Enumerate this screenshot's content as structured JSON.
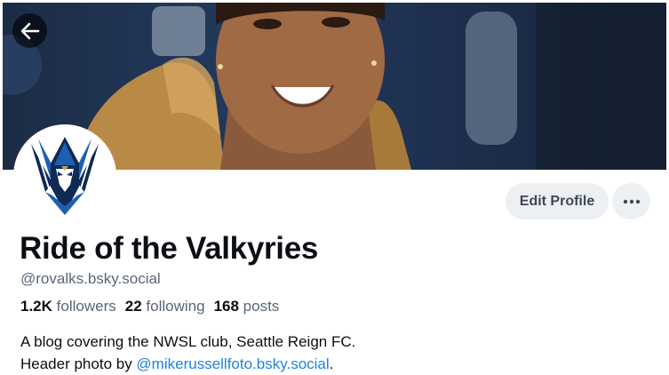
{
  "header": {
    "banner_alt": "Header photo",
    "back_icon": "arrow-left-icon",
    "avatar_icon": "valkyrie-logo-icon"
  },
  "actions": {
    "edit_profile_label": "Edit Profile",
    "more_icon": "ellipsis-icon"
  },
  "profile": {
    "display_name": "Ride of the Valkyries",
    "handle": "@rovalks.bsky.social",
    "stats": {
      "followers_count": "1.2K",
      "followers_label": "followers",
      "following_count": "22",
      "following_label": "following",
      "posts_count": "168",
      "posts_label": "posts"
    },
    "bio": {
      "line1": "A blog covering the NWSL club, Seattle Reign FC.",
      "line2_prefix": "Header photo by ",
      "line2_link": "@mikerussellfoto.bsky.social",
      "line2_suffix": "."
    }
  },
  "colors": {
    "link": "#1d83e0",
    "muted_text": "#5a6675",
    "button_bg": "#edf0f3",
    "avatar_blue": "#1f5fb0",
    "avatar_navy": "#0f2a55"
  }
}
